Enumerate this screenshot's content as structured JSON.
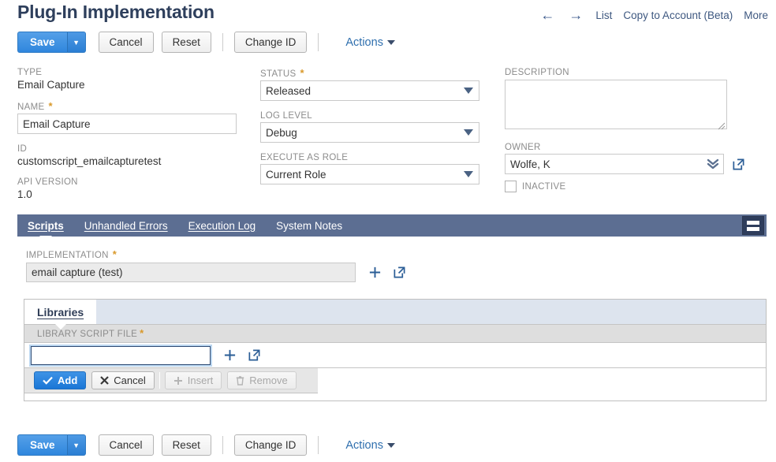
{
  "header": {
    "title": "Plug-In Implementation",
    "nav": {
      "back_icon": "arrow-left-icon",
      "forward_icon": "arrow-right-icon",
      "list_label": "List",
      "copy_label": "Copy to Account (Beta)",
      "more_label": "More"
    }
  },
  "toolbar": {
    "save_label": "Save",
    "save_dropdown_icon": "chevron-down-icon",
    "cancel_label": "Cancel",
    "reset_label": "Reset",
    "change_id_label": "Change ID",
    "actions_label": "Actions"
  },
  "fields": {
    "type": {
      "label": "TYPE",
      "value": "Email Capture"
    },
    "name": {
      "label": "NAME",
      "value": "Email Capture",
      "required": "*",
      "placeholder": ""
    },
    "id": {
      "label": "ID",
      "value": "customscript_emailcapturetest"
    },
    "api_version": {
      "label": "API VERSION",
      "value": "1.0"
    },
    "status": {
      "label": "STATUS",
      "value": "Released",
      "required": "*"
    },
    "log_level": {
      "label": "LOG LEVEL",
      "value": "Debug"
    },
    "execute_as_role": {
      "label": "EXECUTE AS ROLE",
      "value": "Current Role"
    },
    "description": {
      "label": "DESCRIPTION",
      "value": "",
      "placeholder": ""
    },
    "owner": {
      "label": "OWNER",
      "value": "Wolfe, K",
      "popout_icon": "open-in-new-icon"
    },
    "inactive": {
      "label": "INACTIVE",
      "checked": "false"
    }
  },
  "tabs": {
    "items": [
      {
        "label": "Scripts",
        "active": "true"
      },
      {
        "label": "Unhandled Errors",
        "active": "false"
      },
      {
        "label": "Execution Log",
        "active": "false"
      },
      {
        "label": "System Notes",
        "active": "false"
      }
    ],
    "layout_button_icon": "layout-rows-icon"
  },
  "implementation": {
    "label": "IMPLEMENTATION",
    "required": "*",
    "value": "email capture (test)",
    "dropdown_icon": "double-chevron-down-icon",
    "add_icon": "plus-icon",
    "popout_icon": "open-in-new-icon"
  },
  "libraries": {
    "tab_label": "Libraries",
    "column_label": "LIBRARY SCRIPT FILE",
    "required": "*",
    "field_value": "",
    "dropdown_icon": "double-chevron-down-icon",
    "add_icon": "plus-icon",
    "popout_icon": "open-in-new-icon",
    "buttons": {
      "add_label": "Add",
      "add_icon": "check-icon",
      "cancel_label": "Cancel",
      "cancel_icon": "close-x-icon",
      "insert_label": "Insert",
      "insert_icon": "plus-icon",
      "remove_label": "Remove",
      "remove_icon": "trash-icon"
    }
  },
  "colors": {
    "primary_blue": "#2f86dd",
    "tabbar_slate": "#5c6e92",
    "required_orange": "#d9992b",
    "link_blue": "#2f6fae",
    "subtab_strip": "#dde4ee"
  }
}
